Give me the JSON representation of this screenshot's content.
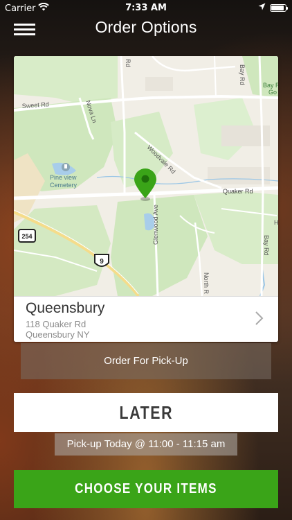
{
  "status_bar": {
    "carrier": "Carrier",
    "time": "7:33 AM",
    "battery_level": 0.9
  },
  "header": {
    "title": "Order Options",
    "menu_icon": "hamburger-menu-icon"
  },
  "map": {
    "labels": {
      "sweet_rd": "Sweet Rd",
      "nova_ln": "Nova Ln",
      "rd_top": "Rd",
      "bay_rd_top": "Bay Rd",
      "bay_r_go": "Bay R",
      "go": "Go",
      "woodvale": "Woodvale Rd",
      "quaker_rd": "Quaker Rd",
      "pineview_1": "Pine view",
      "pineview_2": "Cemetery",
      "glenwood": "Glenwood Ave",
      "bay_rd_lower": "Bay Rd",
      "north_r": "North R",
      "shield_254": "254",
      "shield_9": "9",
      "edge_h": "H"
    },
    "pin_color": "#3aa418"
  },
  "location": {
    "name": "Queensbury",
    "street": "118 Quaker Rd",
    "city": "Queensbury NY"
  },
  "buttons": {
    "pickup": "Order For Pick-Up",
    "later": "LATER",
    "pickup_time": "Pick-up Today @ 11:00 - 11:15 am",
    "choose_items": "CHOOSE YOUR ITEMS"
  },
  "colors": {
    "accent_green": "#3aa418"
  }
}
